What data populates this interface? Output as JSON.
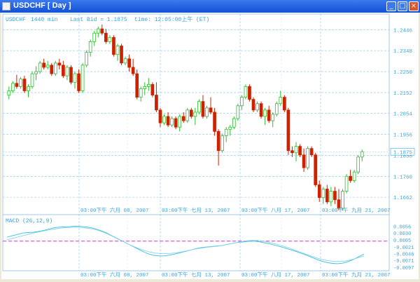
{
  "window": {
    "title": "USDCHF [ Day ]",
    "minimize_symbol": "_",
    "maximize_symbol": "□",
    "close_symbol": "×",
    "titlebar_color": "#1f5ae0"
  },
  "header": {
    "symbol": "USDCHF",
    "timeframe": "1440 min",
    "last_bid": "Last Bid = 1.1875",
    "time": "time: 12:05:00上午 (ET)"
  },
  "colors": {
    "up": "#2bbf2b",
    "down": "#cc2200",
    "grid": "#87c4ee",
    "axis_text": "#3aa3dc",
    "macd_line": "#3bbdd9",
    "signal_line": "#7fd4ee",
    "zero_line": "#cc33cc"
  },
  "price_axis": {
    "ticks": [
      "1.2446",
      "1.2348",
      "1.2250",
      "1.2152",
      "1.2054",
      "1.1956",
      "1.1858",
      "1.1760",
      "1.1662"
    ],
    "last_label": "1.1875"
  },
  "time_axis": {
    "labels": [
      "03:00下午 六月 08, 2007",
      "03:00下午 七月 13, 2007",
      "03:00下午 八月 17, 2007",
      "03:00下午 九月 21, 2007"
    ]
  },
  "macd": {
    "label": "MACD (26,12,9)",
    "ticks": [
      "0.0056",
      "0.0030",
      "0.0005",
      "-0.0021",
      "-0.0046",
      "-0.0071",
      "-0.0097"
    ]
  },
  "chart_data": {
    "type": "candlestick",
    "series": [
      {
        "name": "USDCHF",
        "ohlc": [
          [
            1.214,
            1.218,
            1.212,
            1.216
          ],
          [
            1.216,
            1.2205,
            1.215,
            1.2195
          ],
          [
            1.2195,
            1.2235,
            1.217,
            1.218
          ],
          [
            1.218,
            1.2225,
            1.217,
            1.2215
          ],
          [
            1.2215,
            1.223,
            1.215,
            1.216
          ],
          [
            1.216,
            1.219,
            1.213,
            1.218
          ],
          [
            1.218,
            1.225,
            1.217,
            1.224
          ],
          [
            1.224,
            1.2275,
            1.221,
            1.225
          ],
          [
            1.225,
            1.23,
            1.224,
            1.229
          ],
          [
            1.229,
            1.231,
            1.226,
            1.227
          ],
          [
            1.227,
            1.23,
            1.226,
            1.228
          ],
          [
            1.228,
            1.229,
            1.223,
            1.224
          ],
          [
            1.224,
            1.23,
            1.223,
            1.229
          ],
          [
            1.229,
            1.231,
            1.226,
            1.228
          ],
          [
            1.228,
            1.23,
            1.222,
            1.223
          ],
          [
            1.223,
            1.228,
            1.221,
            1.227
          ],
          [
            1.227,
            1.228,
            1.219,
            1.22
          ],
          [
            1.22,
            1.225,
            1.217,
            1.224
          ],
          [
            1.224,
            1.226,
            1.215,
            1.216
          ],
          [
            1.216,
            1.229,
            1.215,
            1.228
          ],
          [
            1.228,
            1.235,
            1.227,
            1.234
          ],
          [
            1.234,
            1.24,
            1.232,
            1.239
          ],
          [
            1.239,
            1.244,
            1.237,
            1.243
          ],
          [
            1.243,
            1.246,
            1.241,
            1.245
          ],
          [
            1.245,
            1.247,
            1.242,
            1.243
          ],
          [
            1.243,
            1.245,
            1.238,
            1.239
          ],
          [
            1.239,
            1.242,
            1.238,
            1.241
          ],
          [
            1.241,
            1.242,
            1.232,
            1.233
          ],
          [
            1.233,
            1.238,
            1.23,
            1.237
          ],
          [
            1.237,
            1.238,
            1.228,
            1.229
          ],
          [
            1.229,
            1.232,
            1.228,
            1.231
          ],
          [
            1.231,
            1.233,
            1.225,
            1.227
          ],
          [
            1.227,
            1.231,
            1.223,
            1.224
          ],
          [
            1.224,
            1.226,
            1.212,
            1.213
          ],
          [
            1.213,
            1.218,
            1.211,
            1.217
          ],
          [
            1.217,
            1.22,
            1.214,
            1.218
          ],
          [
            1.218,
            1.222,
            1.216,
            1.219
          ],
          [
            1.219,
            1.22,
            1.213,
            1.214
          ],
          [
            1.214,
            1.22,
            1.206,
            1.207
          ],
          [
            1.207,
            1.208,
            1.199,
            1.201
          ],
          [
            1.201,
            1.205,
            1.2,
            1.204
          ],
          [
            1.204,
            1.206,
            1.199,
            1.2
          ],
          [
            1.2,
            1.204,
            1.199,
            1.203
          ],
          [
            1.203,
            1.204,
            1.198,
            1.199
          ],
          [
            1.199,
            1.205,
            1.197,
            1.204
          ],
          [
            1.204,
            1.206,
            1.201,
            1.202
          ],
          [
            1.202,
            1.208,
            1.201,
            1.207
          ],
          [
            1.207,
            1.208,
            1.203,
            1.204
          ],
          [
            1.204,
            1.208,
            1.2,
            1.206
          ],
          [
            1.206,
            1.212,
            1.205,
            1.211
          ],
          [
            1.211,
            1.214,
            1.203,
            1.204
          ],
          [
            1.204,
            1.209,
            1.203,
            1.208
          ],
          [
            1.208,
            1.213,
            1.205,
            1.206
          ],
          [
            1.206,
            1.208,
            1.195,
            1.197
          ],
          [
            1.197,
            1.198,
            1.181,
            1.188
          ],
          [
            1.188,
            1.196,
            1.187,
            1.195
          ],
          [
            1.195,
            1.199,
            1.192,
            1.198
          ],
          [
            1.198,
            1.2,
            1.195,
            1.199
          ],
          [
            1.199,
            1.204,
            1.198,
            1.203
          ],
          [
            1.203,
            1.21,
            1.202,
            1.209
          ],
          [
            1.209,
            1.214,
            1.207,
            1.213
          ],
          [
            1.213,
            1.219,
            1.212,
            1.218
          ],
          [
            1.218,
            1.219,
            1.211,
            1.212
          ],
          [
            1.212,
            1.213,
            1.206,
            1.207
          ],
          [
            1.207,
            1.211,
            1.206,
            1.21
          ],
          [
            1.21,
            1.211,
            1.203,
            1.204
          ],
          [
            1.204,
            1.208,
            1.2,
            1.207
          ],
          [
            1.207,
            1.209,
            1.201,
            1.202
          ],
          [
            1.202,
            1.206,
            1.199,
            1.205
          ],
          [
            1.205,
            1.211,
            1.204,
            1.21
          ],
          [
            1.21,
            1.216,
            1.209,
            1.213
          ],
          [
            1.213,
            1.214,
            1.206,
            1.207
          ],
          [
            1.207,
            1.208,
            1.186,
            1.188
          ],
          [
            1.188,
            1.19,
            1.185,
            1.187
          ],
          [
            1.187,
            1.192,
            1.183,
            1.19
          ],
          [
            1.19,
            1.191,
            1.185,
            1.186
          ],
          [
            1.186,
            1.189,
            1.178,
            1.18
          ],
          [
            1.18,
            1.19,
            1.179,
            1.189
          ],
          [
            1.189,
            1.19,
            1.185,
            1.186
          ],
          [
            1.186,
            1.187,
            1.171,
            1.172
          ],
          [
            1.172,
            1.174,
            1.164,
            1.166
          ],
          [
            1.166,
            1.171,
            1.163,
            1.17
          ],
          [
            1.17,
            1.172,
            1.163,
            1.164
          ],
          [
            1.164,
            1.171,
            1.162,
            1.169
          ],
          [
            1.169,
            1.171,
            1.163,
            1.165
          ],
          [
            1.165,
            1.17,
            1.16,
            1.161
          ],
          [
            1.161,
            1.17,
            1.16,
            1.169
          ],
          [
            1.169,
            1.177,
            1.168,
            1.176
          ],
          [
            1.176,
            1.179,
            1.173,
            1.174
          ],
          [
            1.174,
            1.179,
            1.173,
            1.178
          ],
          [
            1.178,
            1.186,
            1.177,
            1.185
          ],
          [
            1.185,
            1.1885,
            1.183,
            1.1875
          ]
        ]
      }
    ],
    "macd_values": [
      0.0015,
      0.002,
      0.0025,
      0.003,
      0.0032,
      0.0033,
      0.0036,
      0.004,
      0.0045,
      0.005,
      0.0052,
      0.0053,
      0.0054,
      0.0056,
      0.0055,
      0.0053,
      0.005,
      0.0045,
      0.0038,
      0.003,
      0.002,
      0.001,
      0.0,
      -0.001,
      -0.002,
      -0.003,
      -0.004,
      -0.0048,
      -0.0053,
      -0.0055,
      -0.0055,
      -0.0052,
      -0.0048,
      -0.0043,
      -0.0038,
      -0.0033,
      -0.0028,
      -0.0024,
      -0.0022,
      -0.002,
      -0.0018,
      -0.0016,
      -0.0012,
      -0.0008,
      -0.0005,
      -0.0003,
      -0.0001,
      0.0,
      -0.0002,
      -0.0006,
      -0.001,
      -0.0015,
      -0.002,
      -0.0026,
      -0.0032,
      -0.0038,
      -0.0045,
      -0.0052,
      -0.006,
      -0.0068,
      -0.0075,
      -0.008,
      -0.0083,
      -0.0084,
      -0.0082,
      -0.0076,
      -0.0068,
      -0.0058,
      -0.0048
    ],
    "signal_values": [
      0.0005,
      0.001,
      0.0015,
      0.002,
      0.0025,
      0.003,
      0.0034,
      0.0038,
      0.0042,
      0.0045,
      0.0048,
      0.005,
      0.0051,
      0.0052,
      0.0051,
      0.0049,
      0.0046,
      0.0042,
      0.0036,
      0.0028,
      0.0019,
      0.0009,
      0.0,
      -0.001,
      -0.0019,
      -0.0027,
      -0.0034,
      -0.004,
      -0.0044,
      -0.0046,
      -0.0047,
      -0.0046,
      -0.0044,
      -0.0041,
      -0.0037,
      -0.0033,
      -0.0029,
      -0.0026,
      -0.0023,
      -0.0021,
      -0.0019,
      -0.0016,
      -0.0012,
      -0.0008,
      -0.0004,
      -0.0001,
      0.0002,
      0.0003,
      0.0002,
      -0.0001,
      -0.0005,
      -0.001,
      -0.0015,
      -0.0021,
      -0.0028,
      -0.0035,
      -0.0042,
      -0.0049,
      -0.0056,
      -0.0063,
      -0.0068,
      -0.0072,
      -0.0075,
      -0.0076,
      -0.0075,
      -0.0072,
      -0.0067,
      -0.0061,
      -0.0055
    ],
    "ylim": [
      1.16,
      1.248
    ],
    "macd_ylim": [
      -0.01,
      0.0062
    ]
  }
}
